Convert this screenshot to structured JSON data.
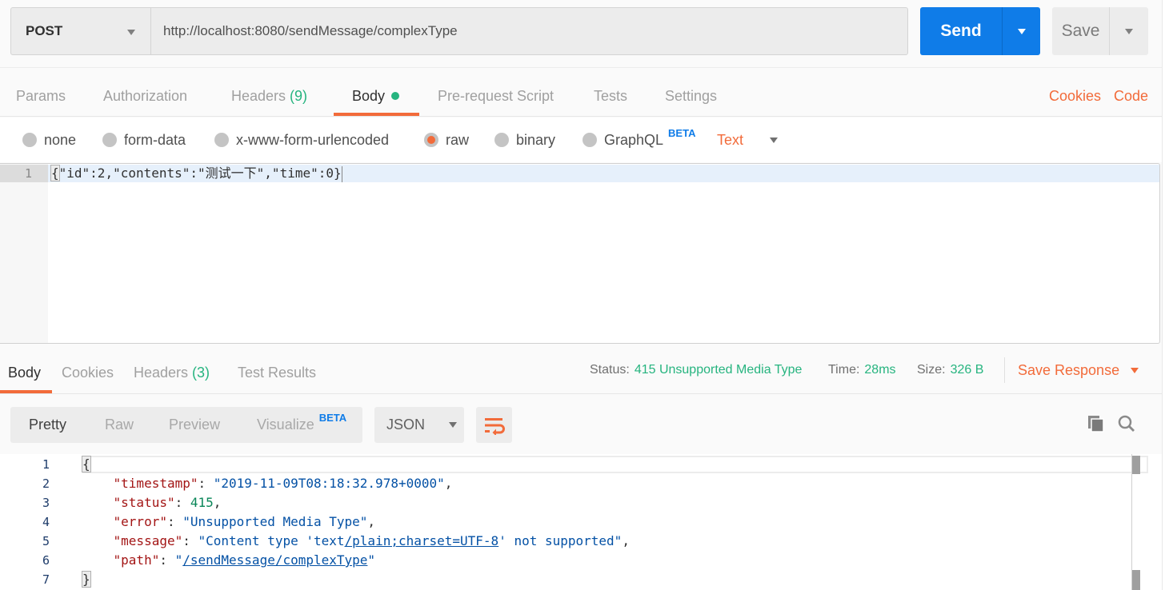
{
  "request": {
    "method": "POST",
    "url": "http://localhost:8080/sendMessage/complexType",
    "send_label": "Send",
    "save_label": "Save"
  },
  "request_tabs": [
    {
      "label": "Params",
      "active": false
    },
    {
      "label": "Authorization",
      "active": false
    },
    {
      "label": "Headers",
      "count": "(9)",
      "active": false
    },
    {
      "label": "Body",
      "active": true,
      "indicator": "green-dot"
    },
    {
      "label": "Pre-request Script",
      "active": false
    },
    {
      "label": "Tests",
      "active": false
    },
    {
      "label": "Settings",
      "active": false
    }
  ],
  "links": {
    "cookies": "Cookies",
    "code": "Code"
  },
  "body_types": [
    {
      "label": "none",
      "selected": false
    },
    {
      "label": "form-data",
      "selected": false
    },
    {
      "label": "x-www-form-urlencoded",
      "selected": false
    },
    {
      "label": "raw",
      "selected": true
    },
    {
      "label": "binary",
      "selected": false
    },
    {
      "label": "GraphQL",
      "selected": false,
      "badge": "BETA"
    }
  ],
  "raw_format": "Text",
  "request_body": {
    "lines": [
      {
        "number": "1",
        "text": "{\"id\":2,\"contents\":\"测试一下\",\"time\":0}"
      }
    ]
  },
  "response_tabs": [
    {
      "label": "Body",
      "active": true
    },
    {
      "label": "Cookies",
      "active": false
    },
    {
      "label": "Headers",
      "count": "(3)",
      "active": false
    },
    {
      "label": "Test Results",
      "active": false
    }
  ],
  "response_meta": {
    "status_label": "Status:",
    "status_value": "415 Unsupported Media Type",
    "time_label": "Time:",
    "time_value": "28ms",
    "size_label": "Size:",
    "size_value": "326 B",
    "save_response": "Save Response"
  },
  "response_views": [
    {
      "label": "Pretty",
      "active": true
    },
    {
      "label": "Raw",
      "active": false
    },
    {
      "label": "Preview",
      "active": false
    },
    {
      "label": "Visualize",
      "active": false,
      "badge": "BETA"
    }
  ],
  "response_format": "JSON",
  "icons": {
    "wrap": "wrap-lines-icon",
    "copy": "copy-icon",
    "search": "search-icon"
  },
  "colors": {
    "accent_orange": "#f26b3a",
    "send_blue": "#0f7ce8",
    "status_green": "#26b47f",
    "beta_blue": "#0f7ce8"
  },
  "response_body": {
    "line_numbers": [
      "1",
      "2",
      "3",
      "4",
      "5",
      "6",
      "7"
    ],
    "l1": "{",
    "l2_key": "\"timestamp\"",
    "l2_val": "\"2019-11-09T08:18:32.978+0000\"",
    "l3_key": "\"status\"",
    "l3_val": "415",
    "l4_key": "\"error\"",
    "l4_val": "\"Unsupported Media Type\"",
    "l5_key": "\"message\"",
    "l5_val_a": "\"Content type 'text",
    "l5_val_link": "/plain;charset=UTF-8",
    "l5_val_b": "' not supported\"",
    "l6_key": "\"path\"",
    "l6_val_a": "\"",
    "l6_val_link": "/sendMessage/complexType",
    "l6_val_b": "\"",
    "l7": "}"
  }
}
